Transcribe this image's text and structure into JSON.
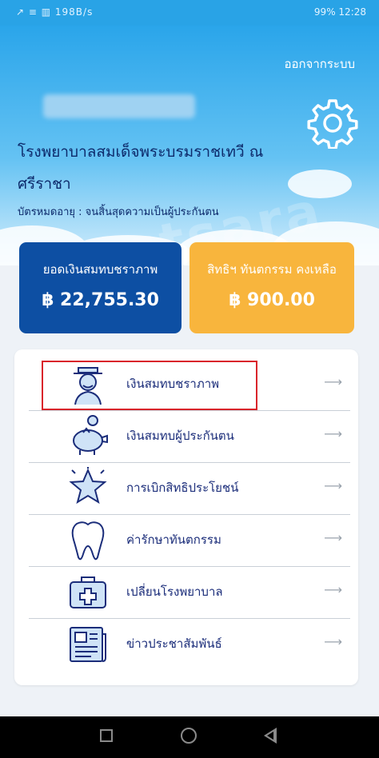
{
  "status_bar": {
    "left_text": "↗ ≡ ▥ 198B/s",
    "right_text": "99% 12:28"
  },
  "header": {
    "logout_label": "ออกจากระบบ",
    "username": "",
    "hospital_name": "โรงพยาบาลสมเด็จพระบรมราชเทวี ณ ศรีราชา",
    "card_expiry": "บัตรหมดอายุ : จนสิ้นสุดความเป็นผู้ประกันตน",
    "watermark": "postsara"
  },
  "cards": [
    {
      "title": "ยอดเงินสมทบชราภาพ",
      "value": "฿ 22,755.30"
    },
    {
      "title": "สิทธิฯ ทันตกรรม คงเหลือ",
      "value": "฿ 900.00"
    }
  ],
  "menu": {
    "items": [
      {
        "label": "เงินสมทบชราภาพ",
        "icon": "elderly-man-icon"
      },
      {
        "label": "เงินสมทบผู้ประกันตน",
        "icon": "piggy-bank-icon"
      },
      {
        "label": "การเบิกสิทธิประโยชน์",
        "icon": "star-icon"
      },
      {
        "label": "ค่ารักษาทันตกรรม",
        "icon": "tooth-icon"
      },
      {
        "label": "เปลี่ยนโรงพยาบาล",
        "icon": "medical-kit-icon"
      },
      {
        "label": "ข่าวประชาสัมพันธ์",
        "icon": "newspaper-icon"
      }
    ],
    "arrow": "⟶"
  },
  "colors": {
    "header_top": "#2aa5ea",
    "card_blue": "#0d4fa3",
    "card_orange": "#f8b53d",
    "text_navy": "#1b2d7a",
    "highlight_red": "#d9252b"
  }
}
